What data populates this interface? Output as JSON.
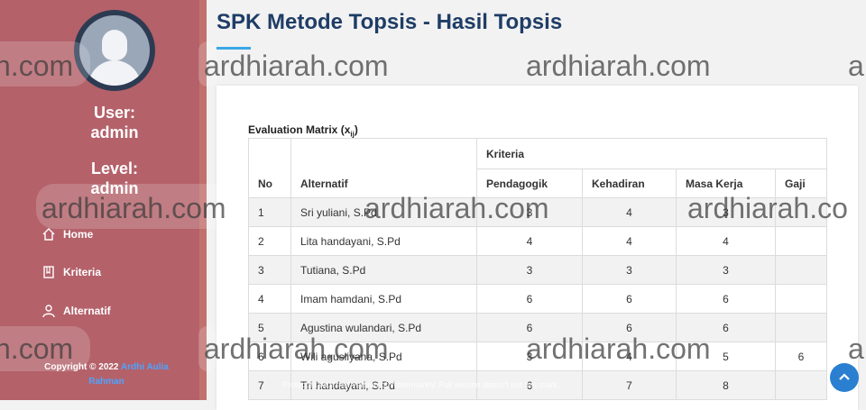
{
  "sidebar": {
    "user_label": "User:",
    "user_value": "admin",
    "level_label": "Level:",
    "level_value": "admin",
    "nav": [
      {
        "label": "Home",
        "icon": "home-icon"
      },
      {
        "label": "Kriteria",
        "icon": "book-icon"
      },
      {
        "label": "Alternatif",
        "icon": "user-icon"
      }
    ],
    "copyright_prefix": "Copyright © 2022",
    "copyright_link_1": "Ardhi Aulia",
    "copyright_link_2": "Rahman"
  },
  "main": {
    "title": "SPK Metode Topsis - Hasil Topsis",
    "matrix_caption": "Evaluation Matrix (x",
    "matrix_caption_sub": "ij",
    "matrix_caption_end": ")",
    "table": {
      "header_no": "No",
      "header_alt": "Alternatif",
      "header_group": "Kriteria",
      "criteria": [
        "Pendagogik",
        "Kehadiran",
        "Masa Kerja",
        "Gaji"
      ],
      "rows": [
        {
          "no": "1",
          "name": "Sri yuliani, S.Pd",
          "v": [
            "3",
            "4",
            "3",
            ""
          ]
        },
        {
          "no": "2",
          "name": "Lita handayani, S.Pd",
          "v": [
            "4",
            "4",
            "4",
            ""
          ]
        },
        {
          "no": "3",
          "name": "Tutiana, S.Pd",
          "v": [
            "3",
            "3",
            "3",
            ""
          ]
        },
        {
          "no": "4",
          "name": "Imam hamdani, S.Pd",
          "v": [
            "6",
            "6",
            "6",
            ""
          ]
        },
        {
          "no": "5",
          "name": "Agustina wulandari, S.Pd",
          "v": [
            "6",
            "6",
            "6",
            ""
          ]
        },
        {
          "no": "6",
          "name": "Wili agusliyana, S.Pd",
          "v": [
            "3",
            "4",
            "5",
            "6"
          ]
        },
        {
          "no": "7",
          "name": "Tri handayani, S.Pd",
          "v": [
            "6",
            "7",
            "8",
            ""
          ]
        }
      ]
    }
  },
  "watermark": {
    "text": "ardhiarah.com",
    "text_partial_right": "a",
    "text_partial_right2": "ardhiarah.co",
    "text_partial_left": "h.com",
    "note": "Protected with free version of Watermarkly. Full version doesn't put this mark."
  },
  "colors": {
    "sidebar": "#b4616a",
    "title": "#1f3d66",
    "accent": "#3aa8e6",
    "button": "#2a7fd0"
  }
}
